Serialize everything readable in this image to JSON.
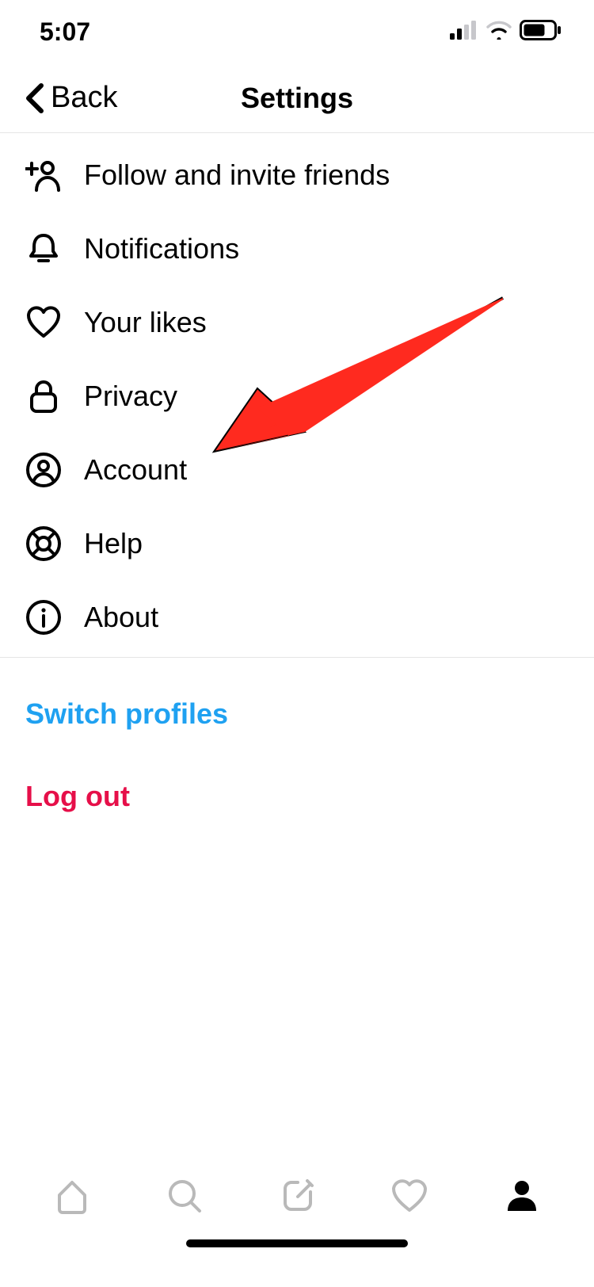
{
  "status": {
    "time": "5:07"
  },
  "header": {
    "back_label": "Back",
    "title": "Settings"
  },
  "menu": {
    "items": [
      {
        "icon": "person-add-icon",
        "label": "Follow and invite friends"
      },
      {
        "icon": "bell-icon",
        "label": "Notifications"
      },
      {
        "icon": "heart-icon",
        "label": "Your likes"
      },
      {
        "icon": "lock-icon",
        "label": "Privacy"
      },
      {
        "icon": "account-circle-icon",
        "label": "Account"
      },
      {
        "icon": "lifebuoy-icon",
        "label": "Help"
      },
      {
        "icon": "info-icon",
        "label": "About"
      }
    ]
  },
  "actions": {
    "switch_profiles": "Switch profiles",
    "log_out": "Log out"
  },
  "annotation": {
    "arrow_color": "#ff2a1f",
    "target": "account"
  },
  "tabbar": {
    "items": [
      "home",
      "search",
      "create",
      "activity",
      "profile"
    ],
    "active": "profile"
  }
}
